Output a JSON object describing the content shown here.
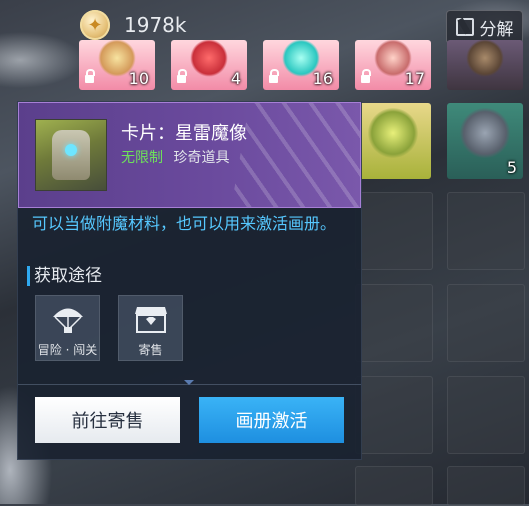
{
  "header": {
    "currency_value": "1978k",
    "decompose_label": "分解",
    "currency_icon": "star-coin-icon"
  },
  "inventory": {
    "top_row_counts": [
      "10",
      "4",
      "16",
      "17"
    ],
    "second_row_count": "5"
  },
  "card_detail": {
    "name": "卡片：星雷魔像",
    "tag_unlimited": "无限制",
    "tag_type": "珍奇道具",
    "description": "可以当做附魔材料，也可以用来激活画册。",
    "section_title": "获取途径",
    "sources": [
      {
        "label": "冒险 · 闯关",
        "icon": "parachute-icon"
      },
      {
        "label": "寄售",
        "icon": "shop-icon"
      }
    ],
    "button_consign": "前往寄售",
    "button_activate": "画册激活"
  },
  "colors": {
    "panel_purple": "#6a4a9d",
    "accent_blue": "#1e8fe0",
    "description_blue": "#56c8ff",
    "tag_green": "#6ee15a"
  }
}
